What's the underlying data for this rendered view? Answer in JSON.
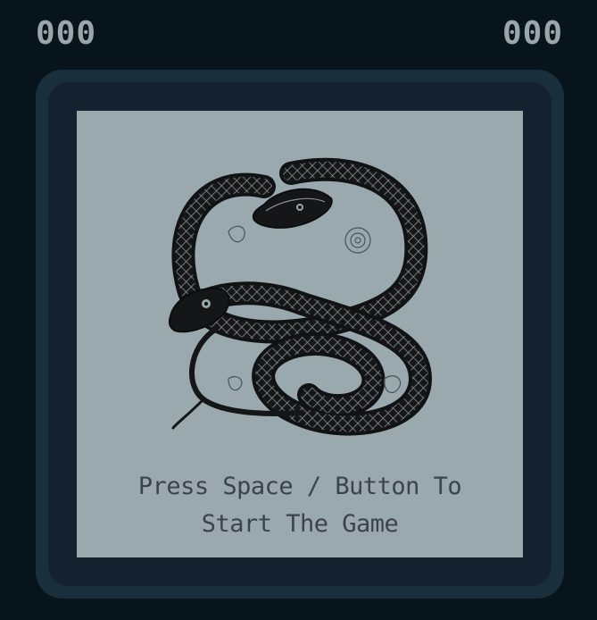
{
  "scores": {
    "left": "000",
    "right": "000"
  },
  "start_message": {
    "line1": "Press Space / Button To",
    "line2": "Start The Game"
  },
  "icons": {
    "artwork": "coiled-snake-illustration"
  },
  "colors": {
    "background": "#08141b",
    "frame": "#1a2e3c",
    "play_area": "#9aa9ad",
    "score_text": "#9aa6ab",
    "message_text": "#3c4449"
  }
}
